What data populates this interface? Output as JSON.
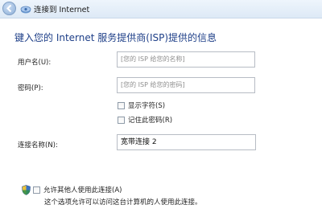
{
  "window": {
    "title": "连接到 Internet"
  },
  "page": {
    "heading": "键入您的 Internet 服务提供商(ISP)提供的信息"
  },
  "form": {
    "username": {
      "label": "用户名(U):",
      "placeholder": "[您的 ISP 给您的名称]",
      "value": ""
    },
    "password": {
      "label": "密码(P):",
      "placeholder": "[您的 ISP 给您的密码]",
      "value": ""
    },
    "show_chars": {
      "label": "显示字符(S)",
      "checked": false
    },
    "remember_password": {
      "label": "记住此密码(R)",
      "checked": false
    },
    "connection_name": {
      "label": "连接名称(N):",
      "value": "宽带连接 2"
    },
    "allow_others": {
      "label": "允许其他人使用此连接(A)",
      "checked": false,
      "description": "这个选项允许可以访问这台计算机的人使用此连接。"
    }
  },
  "icons": {
    "back": "back-arrow-icon",
    "network": "network-connection-icon",
    "shield": "uac-shield-icon"
  }
}
